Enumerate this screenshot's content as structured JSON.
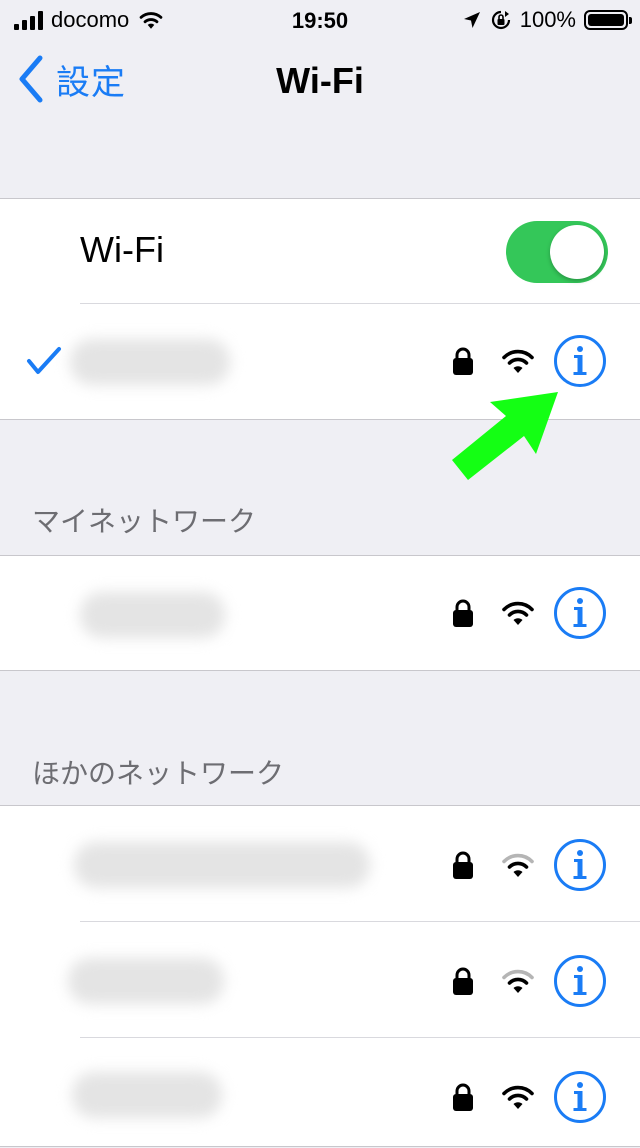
{
  "status_bar": {
    "carrier": "docomo",
    "time": "19:50",
    "battery": "100%",
    "icons": [
      "signal-bars-icon",
      "wifi-icon",
      "location-arrow-icon",
      "orientation-lock-icon",
      "battery-icon"
    ]
  },
  "nav": {
    "back_label": "設定",
    "title": "Wi-Fi"
  },
  "wifi_toggle": {
    "label": "Wi-Fi",
    "on": true
  },
  "connected_network": {
    "checked": true,
    "secured": true,
    "signal": "full",
    "info_icon": "info-icon"
  },
  "sections": {
    "my_networks": {
      "header": "マイネットワーク",
      "networks": [
        {
          "secured": true,
          "signal": "full"
        }
      ]
    },
    "other_networks": {
      "header": "ほかのネットワーク",
      "networks": [
        {
          "secured": true,
          "signal": "weak"
        },
        {
          "secured": true,
          "signal": "weak"
        },
        {
          "secured": true,
          "signal": "full"
        }
      ]
    }
  },
  "annotation": {
    "arrow_icon": "green-arrow-icon",
    "color": "#14ff14"
  },
  "colors": {
    "accent": "#1a7cf5",
    "toggle_on": "#34c759",
    "background": "#efeff4"
  }
}
